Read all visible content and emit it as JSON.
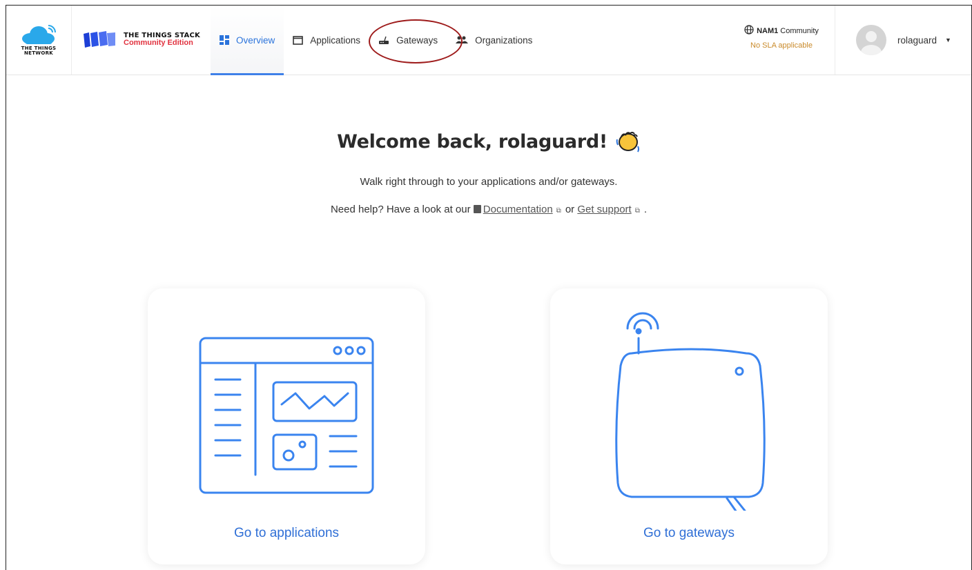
{
  "header": {
    "ttn_logo_text": [
      "THE THINGS",
      "NETWORK"
    ],
    "tts_title": "THE THINGS STACK",
    "tts_edition": "Community Edition",
    "nav": [
      {
        "label": "Overview",
        "icon": "dashboard-icon",
        "active": true
      },
      {
        "label": "Applications",
        "icon": "window-icon",
        "active": false
      },
      {
        "label": "Gateways",
        "icon": "router-icon",
        "active": false
      },
      {
        "label": "Organizations",
        "icon": "people-icon",
        "active": false
      }
    ],
    "cluster": {
      "name": "NAM1",
      "type": "Community",
      "sla": "No SLA applicable"
    },
    "user": {
      "name": "rolaguard"
    }
  },
  "main": {
    "welcome": "Welcome back, rolaguard!",
    "subtitle": "Walk right through to your applications and/or gateways.",
    "help_prefix": "Need help? Have a look at our",
    "documentation_link": "Documentation",
    "or_text": "or",
    "support_link": "Get support",
    "period": ".",
    "cards": [
      {
        "label": "Go to applications",
        "icon": "application-illustration-icon"
      },
      {
        "label": "Go to gateways",
        "icon": "gateway-illustration-icon"
      }
    ]
  },
  "colors": {
    "accent": "#2f6fd6",
    "sla": "#c98a2a",
    "edition": "#e1323f",
    "annotation": "#9e1b1b"
  }
}
